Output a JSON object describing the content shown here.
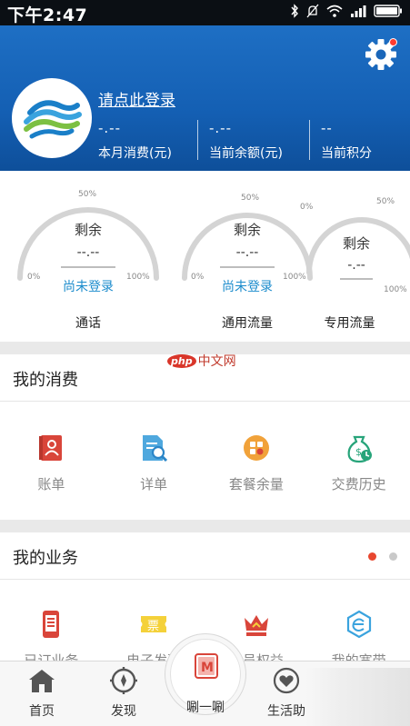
{
  "status_bar": {
    "time": "下午2:47",
    "icons": [
      "bluetooth-icon",
      "mute-icon",
      "wifi-icon",
      "signal-icon",
      "battery-icon"
    ]
  },
  "header": {
    "login_text": "请点此登录",
    "stats": [
      {
        "value": "-.--",
        "label": "本月消费(元)"
      },
      {
        "value": "-.--",
        "label": "当前余额(元)"
      },
      {
        "value": "--",
        "label": "当前积分"
      }
    ],
    "colors": {
      "bg": "#145fb3",
      "notify_dot": "#ff3b2f"
    }
  },
  "gauges": [
    {
      "remaining_label": "剩余",
      "value": "--.--",
      "status": "尚未登录",
      "name": "通话",
      "tick_0": "0%",
      "tick_50": "50%",
      "tick_100": "100%"
    },
    {
      "remaining_label": "剩余",
      "value": "--.--",
      "status": "尚未登录",
      "name": "通用流量",
      "tick_0": "0%",
      "tick_50": "50%",
      "tick_100": "100%"
    },
    {
      "remaining_label": "剩余",
      "value": "-.--",
      "status": "",
      "name": "专用流量",
      "tick_0": "0%",
      "tick_50": "50%",
      "tick_100": "100%"
    }
  ],
  "consumption": {
    "title": "我的消费",
    "items": [
      {
        "label": "账单",
        "icon": "bill-icon"
      },
      {
        "label": "详单",
        "icon": "detail-icon"
      },
      {
        "label": "套餐余量",
        "icon": "package-icon"
      },
      {
        "label": "交费历史",
        "icon": "payment-history-icon"
      }
    ]
  },
  "business": {
    "title": "我的业务",
    "items": [
      {
        "label": "已订业务",
        "icon": "subscribed-phone-icon"
      },
      {
        "label": "电子发票",
        "icon": "invoice-icon"
      },
      {
        "label": "会员权益",
        "icon": "crown-icon"
      },
      {
        "label": "我的宽带",
        "icon": "broadband-icon"
      }
    ],
    "pager": {
      "active": 0,
      "count": 2
    }
  },
  "watermark": {
    "ball": "php",
    "text": "中文网"
  },
  "bottom_nav": {
    "items": [
      {
        "label": "首页",
        "icon": "home-icon"
      },
      {
        "label": "发现",
        "icon": "compass-icon"
      },
      {
        "label": "生活助",
        "icon": "heart-icon"
      }
    ],
    "center": {
      "label": "唰一唰",
      "badge": "M"
    }
  }
}
